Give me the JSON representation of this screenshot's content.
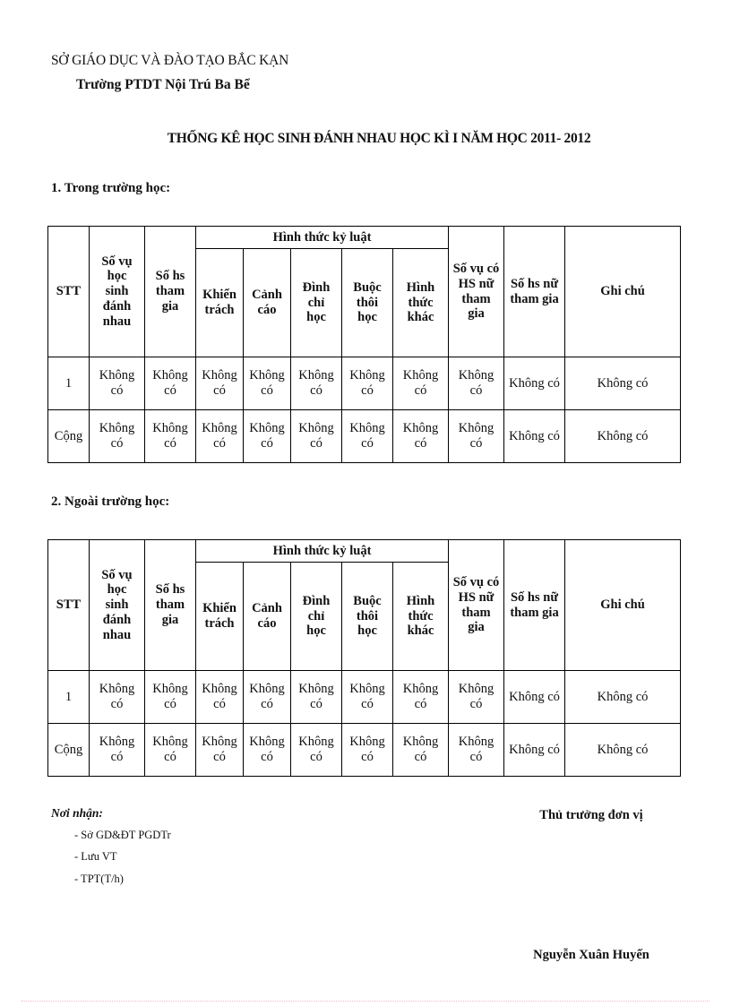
{
  "letterhead": {
    "org": "SỞ GIÁO DỤC VÀ ĐÀO TẠO BẮC KẠN",
    "school": "Trường PTDT Nội Trú Ba Bể"
  },
  "title": "THỐNG KÊ HỌC SINH ĐÁNH NHAU HỌC KÌ I NĂM HỌC 2011- 2012",
  "sections": [
    {
      "heading": "1. Trong trường học:"
    },
    {
      "heading": "2. Ngoài trường học:"
    }
  ],
  "table": {
    "group_header": "Hình thức kỷ luật",
    "columns": {
      "stt": "STT",
      "so_vu_hoc_sinh_danh_nhau": [
        "Số vụ",
        "học",
        "sinh",
        "đánh",
        "nhau"
      ],
      "so_hs_tham_gia": [
        "Số hs",
        "tham",
        "gia"
      ],
      "khien_trach": [
        "Khiển",
        "trách"
      ],
      "canh_cao": [
        "Cảnh",
        "cáo"
      ],
      "dinh_chi_hoc": [
        "Đình",
        "chỉ",
        "học"
      ],
      "buoc_thoi_hoc": [
        "Buộc",
        "thôi",
        "học"
      ],
      "hinh_thuc_khac": [
        "Hình",
        "thức",
        "khác"
      ],
      "so_vu_co_hs_nu_tham_gia": [
        "Số vụ có",
        "HS nữ",
        "tham",
        "gia"
      ],
      "so_hs_nu_tham_gia": [
        "Số hs nữ",
        "tham gia"
      ],
      "ghi_chu": "Ghi chú"
    },
    "rows": [
      {
        "stt": "1",
        "cells_two_line": [
          [
            "Không",
            "có"
          ],
          [
            "Không",
            "có"
          ],
          [
            "Không",
            "có"
          ],
          [
            "Không",
            "có"
          ],
          [
            "Không",
            "có"
          ],
          [
            "Không",
            "có"
          ],
          [
            "Không",
            "có"
          ],
          [
            "Không",
            "có"
          ]
        ],
        "so_hs_nu_tham_gia": "Không có",
        "ghi_chu": "Không có"
      },
      {
        "stt": "Cộng",
        "cells_two_line": [
          [
            "Không",
            "có"
          ],
          [
            "Không",
            "có"
          ],
          [
            "Không",
            "có"
          ],
          [
            "Không",
            "có"
          ],
          [
            "Không",
            "có"
          ],
          [
            "Không",
            "có"
          ],
          [
            "Không",
            "có"
          ],
          [
            "Không",
            "có"
          ]
        ],
        "so_hs_nu_tham_gia": "Không có",
        "ghi_chu": "Không có"
      }
    ]
  },
  "footer": {
    "recipients_title": "Nơi nhận:",
    "recipients": [
      "- Sở GD&ĐT  PGDTr",
      "- Lưu VT",
      "- TPT(T/h)"
    ],
    "signature_role": "Thủ trưởng đơn vị",
    "signature_name": "Nguyễn Xuân Huyến"
  }
}
